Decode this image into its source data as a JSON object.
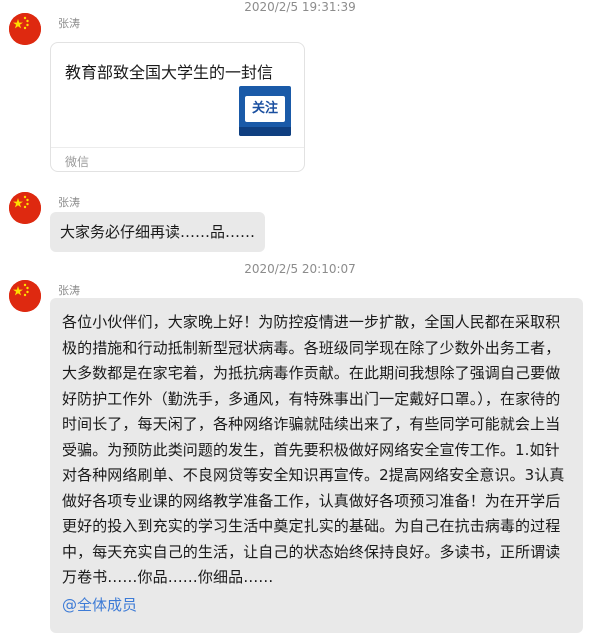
{
  "messages": [
    {
      "timestamp": "2020/2/5 19:31:39",
      "sender": "张涛",
      "card": {
        "title": "教育部致全国大学生的一封信",
        "thumb_text": "关注",
        "source": "微信"
      }
    },
    {
      "sender": "张涛",
      "text": "大家务必仔细再读……品……"
    },
    {
      "timestamp": "2020/2/5 20:10:07",
      "sender": "张涛",
      "text": "各位小伙伴们，大家晚上好！为防控疫情进一步扩散，全国人民都在采取积极的措施和行动抵制新型冠状病毒。各班级同学现在除了少数外出务工者，大多数都是在家宅着，为抵抗病毒作贡献。在此期间我想除了强调自己要做好防护工作外（勤洗手，多通风，有特殊事出门一定戴好口罩。），在家待的时间长了，每天闲了，各种网络诈骗就陆续出来了，有些同学可能就会上当受骗。为预防此类问题的发生，首先要积极做好网络安全宣传工作。1.如针对各种网络刷单、不良网贷等安全知识再宣传。2提高网络安全意识。3认真做好各项专业课的网络教学准备工作，认真做好各项预习准备！为在开学后更好的投入到充实的学习生活中奠定扎实的基础。为自己在抗击病毒的过程中，每天充实自己的生活，让自己的状态始终保持良好。多读书，正所谓读万卷书……你品……你细品……",
      "mention": "@全体成员"
    }
  ],
  "colors": {
    "bubble": "#e9e9e9",
    "mention": "#3d7bd6",
    "avatar_red": "#de2910",
    "avatar_star": "#ffde00"
  },
  "icons": {
    "avatar": "china-flag-avatar-icon"
  }
}
